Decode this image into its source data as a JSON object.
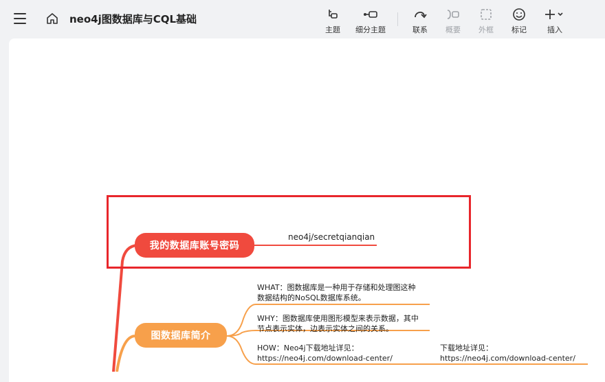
{
  "header": {
    "title": "neo4j图数据库与CQL基础"
  },
  "toolbar": {
    "tools": [
      {
        "label": "主题",
        "icon": "topic-icon",
        "enabled": true
      },
      {
        "label": "细分主题",
        "icon": "subtopic-icon",
        "enabled": true
      },
      {
        "label": "联系",
        "icon": "relationship-icon",
        "enabled": true
      },
      {
        "label": "概要",
        "icon": "summary-icon",
        "enabled": false
      },
      {
        "label": "外框",
        "icon": "boundary-icon",
        "enabled": false
      },
      {
        "label": "标记",
        "icon": "marker-icon",
        "enabled": true
      },
      {
        "label": "插入",
        "icon": "insert-icon",
        "enabled": true
      }
    ]
  },
  "mindmap": {
    "account_node": {
      "label": "我的数据库账号密码",
      "color": "#f04a3e",
      "child": "neo4j/secretqianqian"
    },
    "intro_node": {
      "label": "图数据库简介",
      "color": "#f7a04b",
      "children": [
        {
          "line1": "WHAT：图数据库是一种用于存储和处理图这种",
          "line2": "数据结构的NoSQL数据库系统。"
        },
        {
          "line1": "WHY：图数据库使用图形模型来表示数据，其中",
          "line2": "节点表示实体，边表示实体之间的关系。"
        },
        {
          "line1": "HOW：Neo4j下载地址详见：",
          "line2": "https://neo4j.com/download-center/"
        }
      ],
      "grandchild": {
        "line1": "下载地址详见：",
        "line2": "https://neo4j.com/download-center/"
      }
    },
    "highlight_color": "#e8262b"
  }
}
